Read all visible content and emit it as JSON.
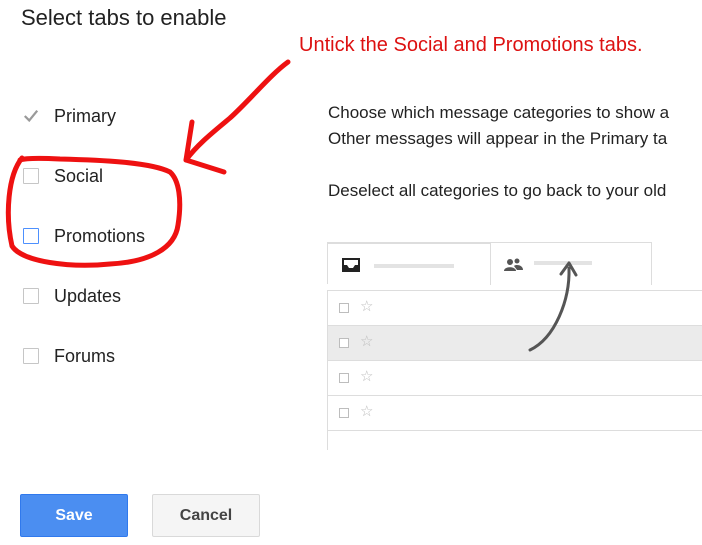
{
  "dialog": {
    "title": "Select tabs to enable"
  },
  "annotation": {
    "text": "Untick the Social and Promotions tabs.",
    "color": "#dd1111"
  },
  "categories": [
    {
      "label": "Primary",
      "checked": true,
      "locked": true
    },
    {
      "label": "Social",
      "checked": false
    },
    {
      "label": "Promotions",
      "checked": false,
      "focused": true
    },
    {
      "label": "Updates",
      "checked": false
    },
    {
      "label": "Forums",
      "checked": false
    }
  ],
  "description": {
    "line1": "Choose which message categories to show a",
    "line2": "Other messages will appear in the Primary ta",
    "line3": "Deselect all categories to go back to your old"
  },
  "preview": {
    "tabs": [
      {
        "icon": "inbox-icon"
      },
      {
        "icon": "people-icon"
      }
    ],
    "rows": [
      {
        "shaded": false
      },
      {
        "shaded": true
      },
      {
        "shaded": false
      },
      {
        "shaded": false
      }
    ]
  },
  "buttons": {
    "save_label": "Save",
    "cancel_label": "Cancel"
  },
  "colors": {
    "save_button": "#4b8ef1",
    "annotation_red": "#ee1111",
    "focus_blue": "#4d90fe"
  }
}
